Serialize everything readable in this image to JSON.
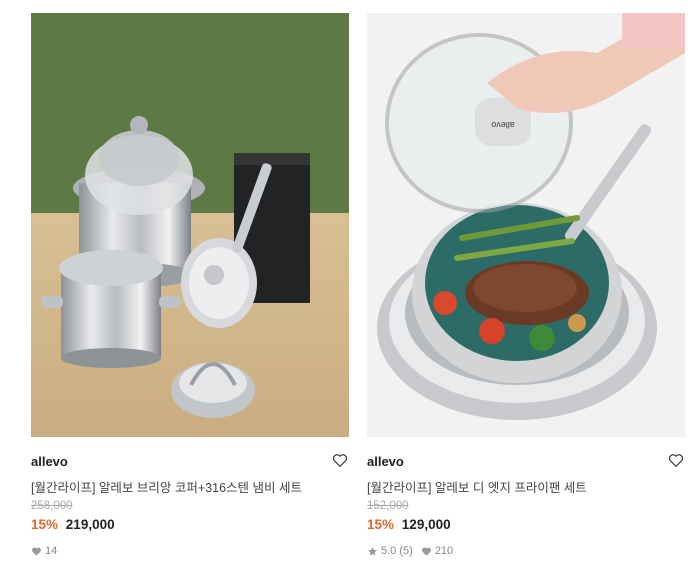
{
  "products": [
    {
      "brand": "allevo",
      "name": "[월간라이프] 알레보 브리앙 코퍼+316스텐 냄비 세트",
      "original_price": "258,000",
      "discount": "15%",
      "price": "219,000",
      "likes": "14",
      "wishlist_icon": "heart-outline-icon",
      "like_icon": "heart-filled-icon"
    },
    {
      "brand": "allevo",
      "name": "[월간라이프] 알레보 디 엣지 프라이팬 세트",
      "original_price": "152,000",
      "discount": "15%",
      "price": "129,000",
      "rating": "5.0",
      "review_count": "(5)",
      "likes": "210",
      "lid_brand": "allevo",
      "wishlist_icon": "heart-outline-icon",
      "rating_icon": "star-icon",
      "like_icon": "heart-filled-icon"
    }
  ],
  "colors": {
    "discount": "#e8642c",
    "muted": "#aaaaaa",
    "text": "#222222"
  }
}
